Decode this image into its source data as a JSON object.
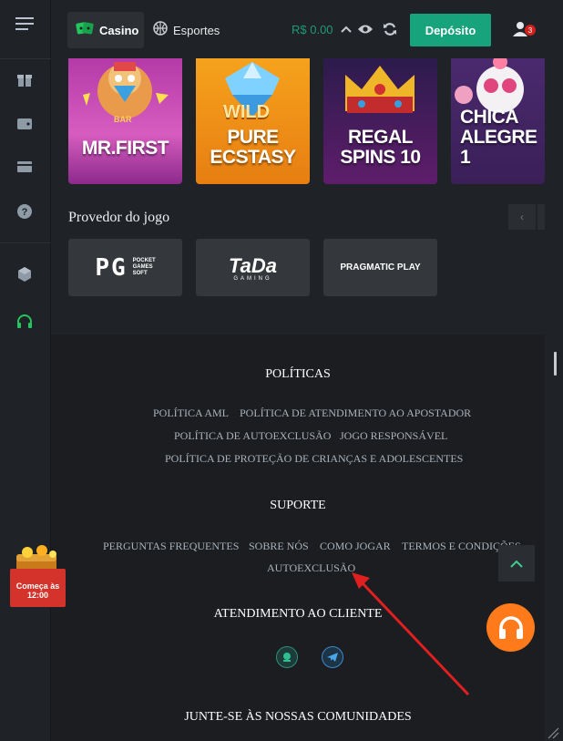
{
  "header": {
    "tabs": {
      "casino": "Casino",
      "esportes": "Esportes"
    },
    "balance": "R$ 0.00",
    "deposit_label": "Depósito",
    "notification_count": "3"
  },
  "games": [
    {
      "title": "MR.FIRST",
      "sublabel": "BAR"
    },
    {
      "title": "PURE\nECSTASY",
      "sublabel": "WILD"
    },
    {
      "title": "REGAL\nSPINS 10",
      "sublabel": ""
    },
    {
      "title": "CHICA\nALEGRE 1",
      "sublabel": ""
    }
  ],
  "providers": {
    "title": "Provedor do jogo",
    "items": [
      {
        "name": "PG",
        "sub": "POCKET\nGAMES\nSOFT"
      },
      {
        "name": "TaDa",
        "sub": "GAMING"
      },
      {
        "name": "PRAGMATIC PLAY",
        "sub": ""
      }
    ]
  },
  "footer": {
    "politicas": {
      "heading": "POLÍTICAS",
      "links": [
        "POLÍTICA AML",
        "POLÍTICA DE ATENDIMENTO AO APOSTADOR",
        "POLÍTICA DE AUTOEXCLUSÃO",
        "JOGO RESPONSÁVEL",
        "POLÍTICA DE PROTEÇÃO DE CRIANÇAS E ADOLESCENTES"
      ]
    },
    "suporte": {
      "heading": "SUPORTE",
      "links": [
        "PERGUNTAS FREQUENTES",
        "SOBRE NÓS",
        "COMO JOGAR",
        "TERMOS E CONDIÇÕES",
        "AUTOEXCLUSÃO"
      ]
    },
    "atendimento_heading": "ATENDIMENTO AO CLIENTE",
    "comunidades_heading": "JUNTE-SE ÀS NOSSAS COMUNIDADES"
  },
  "promo": {
    "label": "Começa às\n12:00"
  },
  "colors": {
    "accent": "#17a37c",
    "balance": "#1f9a77",
    "support_fab": "#ff7a1a",
    "annotation_arrow": "#e02020"
  }
}
